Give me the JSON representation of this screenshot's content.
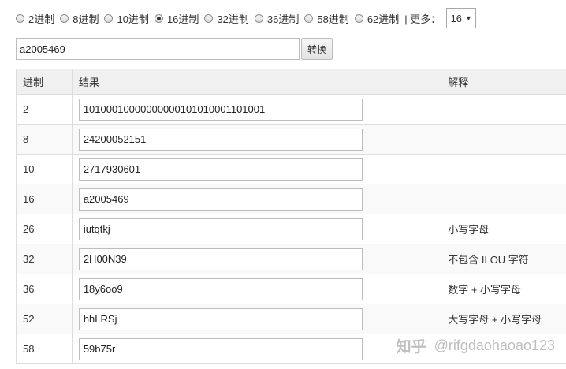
{
  "radix_options": [
    {
      "label": "2进制",
      "checked": false
    },
    {
      "label": "8进制",
      "checked": false
    },
    {
      "label": "10进制",
      "checked": false
    },
    {
      "label": "16进制",
      "checked": true
    },
    {
      "label": "32进制",
      "checked": false
    },
    {
      "label": "36进制",
      "checked": false
    },
    {
      "label": "58进制",
      "checked": false
    },
    {
      "label": "62进制",
      "checked": false
    }
  ],
  "more_label": "| 更多：",
  "more_select_value": "16",
  "input_value": "a2005469",
  "convert_button": "转换",
  "table": {
    "headers": [
      "进制",
      "结果",
      "解释"
    ],
    "rows": [
      {
        "base": "2",
        "result": "10100010000000000101010001101001",
        "note": ""
      },
      {
        "base": "8",
        "result": "24200052151",
        "note": ""
      },
      {
        "base": "10",
        "result": "2717930601",
        "note": ""
      },
      {
        "base": "16",
        "result": "a2005469",
        "note": ""
      },
      {
        "base": "26",
        "result": "iutqtkj",
        "note": "小写字母"
      },
      {
        "base": "32",
        "result": "2H00N39",
        "note": "不包含 ILOU 字符"
      },
      {
        "base": "36",
        "result": "18y6oo9",
        "note": "数字 + 小写字母"
      },
      {
        "base": "52",
        "result": "hhLRSj",
        "note": "大写字母 + 小写字母"
      },
      {
        "base": "58",
        "result": "59b75r",
        "note": ""
      }
    ]
  },
  "watermark": {
    "logo": "知乎",
    "handle": "@rifgdaohaoao123"
  }
}
